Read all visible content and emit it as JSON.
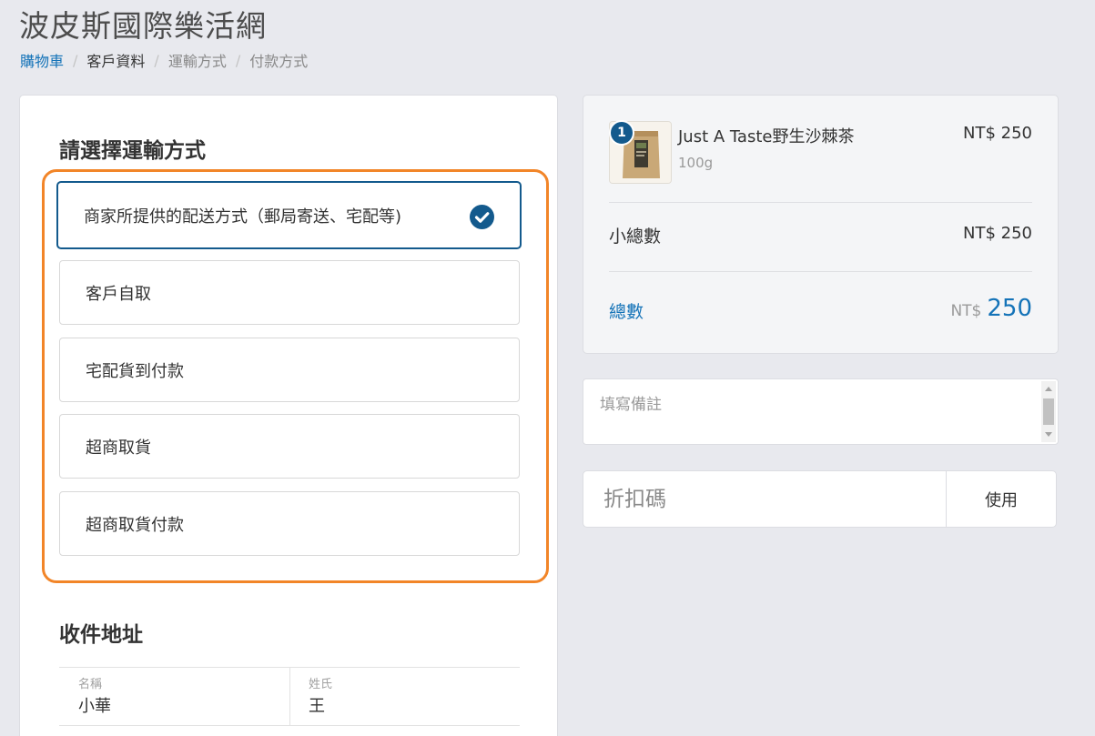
{
  "store": {
    "title": "波皮斯國際樂活網"
  },
  "breadcrumb": {
    "items": [
      "購物車",
      "客戶資料",
      "運輸方式",
      "付款方式"
    ],
    "separator": "/"
  },
  "shipping": {
    "heading": "請選擇運輸方式",
    "options": [
      {
        "label": "商家所提供的配送方式（郵局寄送、宅配等)",
        "selected": true
      },
      {
        "label": "客戶自取",
        "selected": false
      },
      {
        "label": "宅配貨到付款",
        "selected": false
      },
      {
        "label": "超商取貨",
        "selected": false
      },
      {
        "label": "超商取貨付款",
        "selected": false
      }
    ]
  },
  "address": {
    "heading": "收件地址",
    "fields": [
      {
        "label": "名稱",
        "value": "小華"
      },
      {
        "label": "姓氏",
        "value": "王"
      }
    ]
  },
  "summary": {
    "item": {
      "quantity": "1",
      "name": "Just A Taste野生沙棘茶",
      "variant": "100g",
      "price": "NT$ 250"
    },
    "subtotal_label": "小總數",
    "subtotal_value": "NT$ 250",
    "total_label": "總數",
    "total_currency": "NT$",
    "total_amount": "250"
  },
  "note": {
    "placeholder": "填寫備註"
  },
  "coupon": {
    "placeholder": "折扣碼",
    "button_label": "使用"
  },
  "colors": {
    "link": "#1473b8",
    "selected_border": "#135a8d",
    "highlight": "#f28528",
    "background": "#e8e9ee"
  },
  "icons": {
    "selected_option": "check-circle-icon",
    "product_image": "product-thumbnail"
  }
}
